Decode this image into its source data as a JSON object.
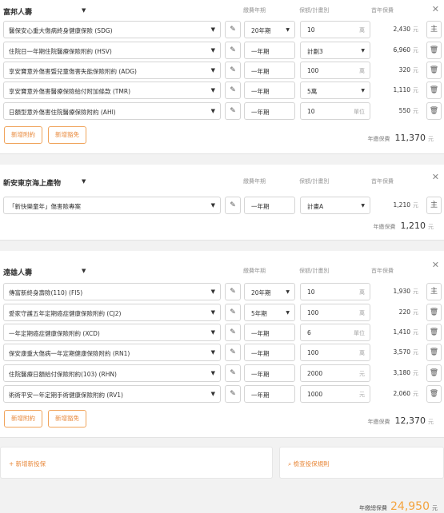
{
  "headers": {
    "term": "繳費年期",
    "amount": "保額/計畫別",
    "premium": "首年保費"
  },
  "currency": "元",
  "companies": [
    {
      "name": "富邦人壽",
      "rows": [
        {
          "product": "醫保安心重大傷病終身健康保險 (SDG)",
          "term": "20年期",
          "term_dd": true,
          "amount": "10",
          "unit": "萬",
          "amount_dd": false,
          "premium": "2,430",
          "action": "主"
        },
        {
          "product": "住院日一年期住院醫療保險附約 (HSV)",
          "term": "一年期",
          "term_dd": false,
          "amount": "計劃3",
          "unit": "",
          "amount_dd": true,
          "premium": "6,960",
          "action": "trash"
        },
        {
          "product": "享安寶意外傷害暨兒童傷害失能保險附約 (ADG)",
          "term": "一年期",
          "term_dd": false,
          "amount": "100",
          "unit": "萬",
          "amount_dd": false,
          "premium": "320",
          "action": "trash"
        },
        {
          "product": "享安寶意外傷害醫療保險給付附加條款 (TMR)",
          "term": "一年期",
          "term_dd": false,
          "amount": "5萬",
          "unit": "",
          "amount_dd": true,
          "premium": "1,110",
          "action": "trash"
        },
        {
          "product": "日額型意外傷害住院醫療保險附約 (AHI)",
          "term": "一年期",
          "term_dd": false,
          "amount": "10",
          "unit": "單位",
          "amount_dd": false,
          "premium": "550",
          "action": "trash"
        }
      ],
      "buttons": [
        "新增附約",
        "新增豁免"
      ],
      "total_label": "年繳保費",
      "total": "11,370"
    },
    {
      "name": "新安東京海上產物",
      "rows": [
        {
          "product": "「新快樂童年」傷害險專案",
          "term": "一年期",
          "term_dd": false,
          "amount": "計畫A",
          "unit": "",
          "amount_dd": true,
          "premium": "1,210",
          "action": "主"
        }
      ],
      "buttons": [],
      "total_label": "年繳保費",
      "total": "1,210"
    },
    {
      "name": "遠雄人壽",
      "rows": [
        {
          "product": "傳富新終身壽險(110) (FI5)",
          "term": "20年期",
          "term_dd": true,
          "amount": "10",
          "unit": "萬",
          "amount_dd": false,
          "premium": "1,930",
          "action": "主"
        },
        {
          "product": "愛家守護五年定期癌症健康保險附約 (CJ2)",
          "term": "5年期",
          "term_dd": true,
          "amount": "100",
          "unit": "萬",
          "amount_dd": false,
          "premium": "220",
          "action": "trash"
        },
        {
          "product": "一年定期癌症健康保險附約 (XCD)",
          "term": "一年期",
          "term_dd": false,
          "amount": "6",
          "unit": "單位",
          "amount_dd": false,
          "premium": "1,410",
          "action": "trash"
        },
        {
          "product": "保安康重大傷病一年定期健康保險附約 (RN1)",
          "term": "一年期",
          "term_dd": false,
          "amount": "100",
          "unit": "萬",
          "amount_dd": false,
          "premium": "3,570",
          "action": "trash"
        },
        {
          "product": "住院醫療日額給付保險附約(103) (RHN)",
          "term": "一年期",
          "term_dd": false,
          "amount": "2000",
          "unit": "元",
          "amount_dd": false,
          "premium": "3,180",
          "action": "trash"
        },
        {
          "product": "術術平安一年定期手術健康保險附約 (RV1)",
          "term": "一年期",
          "term_dd": false,
          "amount": "1000",
          "unit": "元",
          "amount_dd": false,
          "premium": "2,060",
          "action": "trash"
        }
      ],
      "buttons": [
        "新增附約",
        "新增豁免"
      ],
      "total_label": "年繳保費",
      "total": "12,370"
    }
  ],
  "bottom": {
    "add_label": "+ 新增新投保",
    "check_label": "檢查投保規則"
  },
  "grand": {
    "label": "年繳總保費",
    "value": "24,950",
    "unit": "元"
  }
}
